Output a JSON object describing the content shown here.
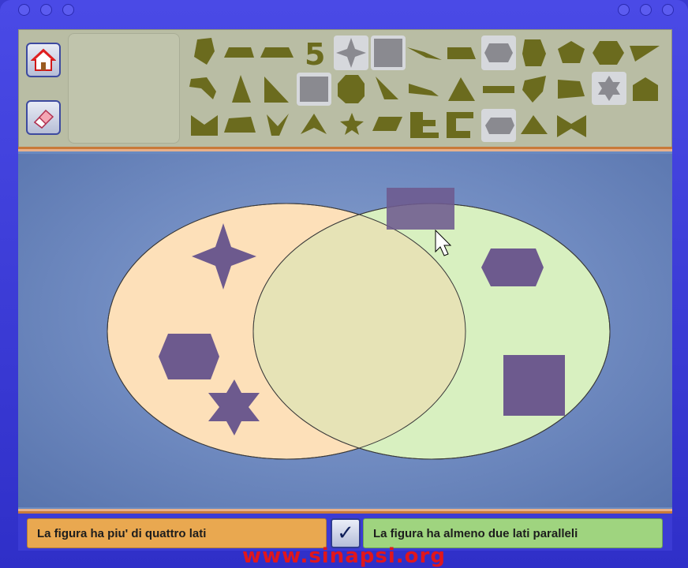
{
  "toolbar": {
    "home_icon": "home-icon",
    "eraser_icon": "eraser-icon",
    "palette_digit": "5"
  },
  "labels": {
    "left_set": "La figura ha piu' di quattro lati",
    "right_set": "La figura ha almeno due lati paralleli",
    "check_symbol": "✓"
  },
  "watermark": "www.sinapsi.org",
  "colors": {
    "shape_fill": "#6d5a8e",
    "palette_shape": "#6b6b1e",
    "left_set": "#fde0b9",
    "right_set": "#d8f0c0",
    "left_label": "#e9a850",
    "right_label": "#9fd47f"
  }
}
